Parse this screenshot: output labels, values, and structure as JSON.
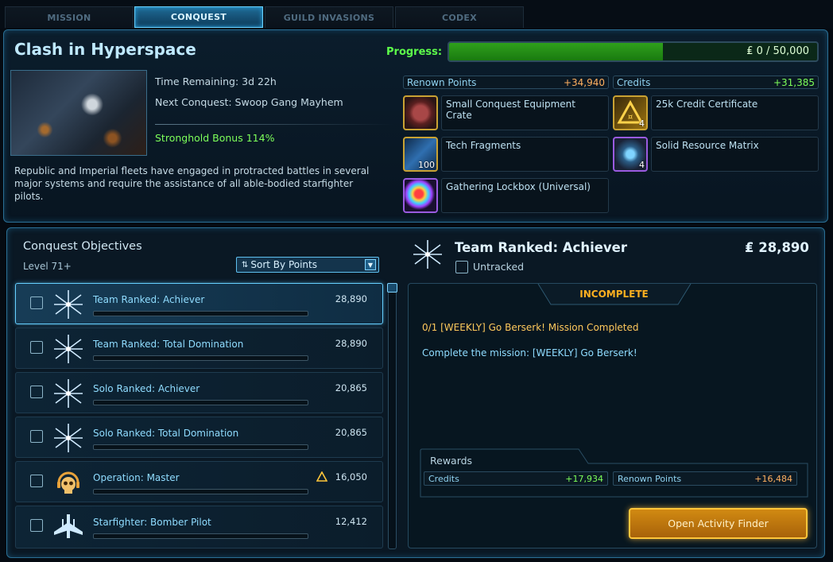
{
  "tabs": [
    {
      "label": "MISSION"
    },
    {
      "label": "CONQUEST"
    },
    {
      "label": "GUILD INVASIONS"
    },
    {
      "label": "CODEX"
    }
  ],
  "conquest": {
    "title": "Clash in Hyperspace",
    "time_remaining": "Time Remaining: 3d 22h",
    "next_conquest": "Next Conquest: Swoop Gang Mayhem",
    "stronghold_bonus": "Stronghold Bonus 114%",
    "description": "Republic and Imperial fleets have engaged in protracted battles in several major systems and require the assistance of all able-bodied starfighter pilots.",
    "progress_label": "Progress:",
    "progress_text": "₤ 0 / 50,000",
    "progress_fraction": 0.58
  },
  "stats": {
    "renown_label": "Renown Points",
    "renown_value": "+34,940",
    "credits_label": "Credits",
    "credits_value": "+31,385"
  },
  "rewards": [
    {
      "name": "Small Conquest Equipment Crate",
      "icon": "crate-icon",
      "qty": ""
    },
    {
      "name": "25k Credit Certificate",
      "icon": "credit-certificate-icon",
      "qty": "4"
    },
    {
      "name": "Tech Fragments",
      "icon": "tech-fragments-icon",
      "qty": "100"
    },
    {
      "name": "Solid Resource Matrix",
      "icon": "resource-matrix-icon",
      "qty": "4"
    },
    {
      "name": "Gathering Lockbox (Universal)",
      "icon": "lockbox-icon",
      "qty": ""
    }
  ],
  "objectives": {
    "title": "Conquest Objectives",
    "level": "Level 71+",
    "sort_label": "Sort By Points",
    "items": [
      {
        "name": "Team Ranked: Achiever",
        "points": "28,890",
        "icon": "starburst-icon"
      },
      {
        "name": "Team Ranked: Total Domination",
        "points": "28,890",
        "icon": "starburst-icon"
      },
      {
        "name": "Solo Ranked: Achiever",
        "points": "20,865",
        "icon": "starburst-icon"
      },
      {
        "name": "Solo Ranked: Total Domination",
        "points": "20,865",
        "icon": "starburst-icon"
      },
      {
        "name": "Operation: Master",
        "points": "16,050",
        "icon": "skull-icon"
      },
      {
        "name": "Starfighter: Bomber Pilot",
        "points": "12,412",
        "icon": "starfighter-icon"
      }
    ]
  },
  "detail": {
    "title": "Team Ranked: Achiever",
    "points": "₤ 28,890",
    "untracked": "Untracked",
    "status": "INCOMPLETE",
    "requirement": "0/1 [WEEKLY] Go Berserk! Mission Completed",
    "instruction": "Complete the mission: [WEEKLY] Go Berserk!",
    "rewards_label": "Rewards",
    "reward_credits_label": "Credits",
    "reward_credits_value": "+17,934",
    "reward_renown_label": "Renown Points",
    "reward_renown_value": "+16,484",
    "finder_button": "Open Activity Finder"
  },
  "colors": {
    "accent": "#6ad2ff",
    "progress_green": "#2fa11c",
    "gold": "#ffc63a"
  }
}
